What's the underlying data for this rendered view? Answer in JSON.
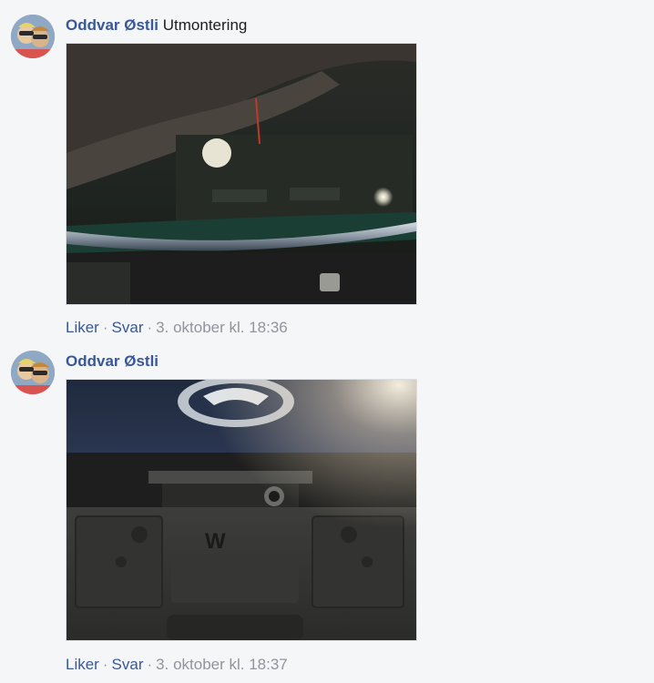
{
  "comments": [
    {
      "author": "Oddvar Østli",
      "text": "Utmontering",
      "photo_icon": "photo-trunk-interior",
      "actions": {
        "like": "Liker",
        "reply": "Svar",
        "separator": "·",
        "timestamp": "3. oktober kl. 18:36"
      }
    },
    {
      "author": "Oddvar Østli",
      "text": "",
      "photo_icon": "photo-license-plate-area",
      "actions": {
        "like": "Liker",
        "reply": "Svar",
        "separator": "·",
        "timestamp": "3. oktober kl. 18:37"
      }
    }
  ],
  "colors": {
    "background": "#f5f6f7",
    "link": "#385898",
    "meta": "#90949c",
    "text": "#1c1e21"
  }
}
